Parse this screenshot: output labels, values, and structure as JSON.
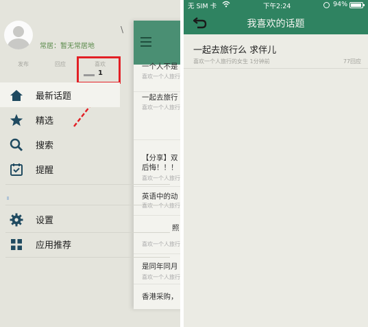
{
  "left": {
    "residence": "常居：暂无常居地",
    "slash_mark": "\\",
    "stats": [
      {
        "label": "发布"
      },
      {
        "label": "回应"
      },
      {
        "label": "喜欢",
        "count": "1"
      }
    ],
    "menu": [
      {
        "label": "最新话题",
        "icon": "home-icon",
        "active": true
      },
      {
        "label": "精选",
        "icon": "star-icon"
      },
      {
        "label": "搜索",
        "icon": "search-icon"
      },
      {
        "label": "提醒",
        "icon": "reminder-icon"
      },
      {
        "label": "设置",
        "icon": "gear-icon"
      },
      {
        "label": "应用推荐",
        "icon": "apps-grid-icon"
      }
    ],
    "feed": [
      {
        "title": "一个人不是",
        "sub": "喜欢一个人旅行"
      },
      {
        "title": "一起去旅行",
        "sub": "喜欢一个人旅行"
      },
      {
        "title": "【分享】双",
        "title2": "后悔！！！",
        "sub": "喜欢一个人旅行"
      },
      {
        "title": "英语中的动",
        "sub": "喜欢一个人旅行"
      },
      {
        "title": "照",
        "sub": "喜欢一个人旅行"
      },
      {
        "title": "是同年同月",
        "sub": "喜欢一个人旅行"
      },
      {
        "title": "香港采购，",
        "sub": ""
      }
    ],
    "colors": {
      "accent": "#4a8f73",
      "highlight": "#e21f25"
    }
  },
  "right": {
    "status": {
      "carrier": "无 SIM 卡",
      "time": "下午2:24",
      "battery": "94%"
    },
    "title": "我喜欢的话题",
    "topics": [
      {
        "title": "一起去旅行么 求伴儿",
        "meta": "喜欢一个人旅行的女生 1分钟前",
        "replies": "77回应"
      }
    ],
    "colors": {
      "bar": "#2f8361"
    }
  }
}
